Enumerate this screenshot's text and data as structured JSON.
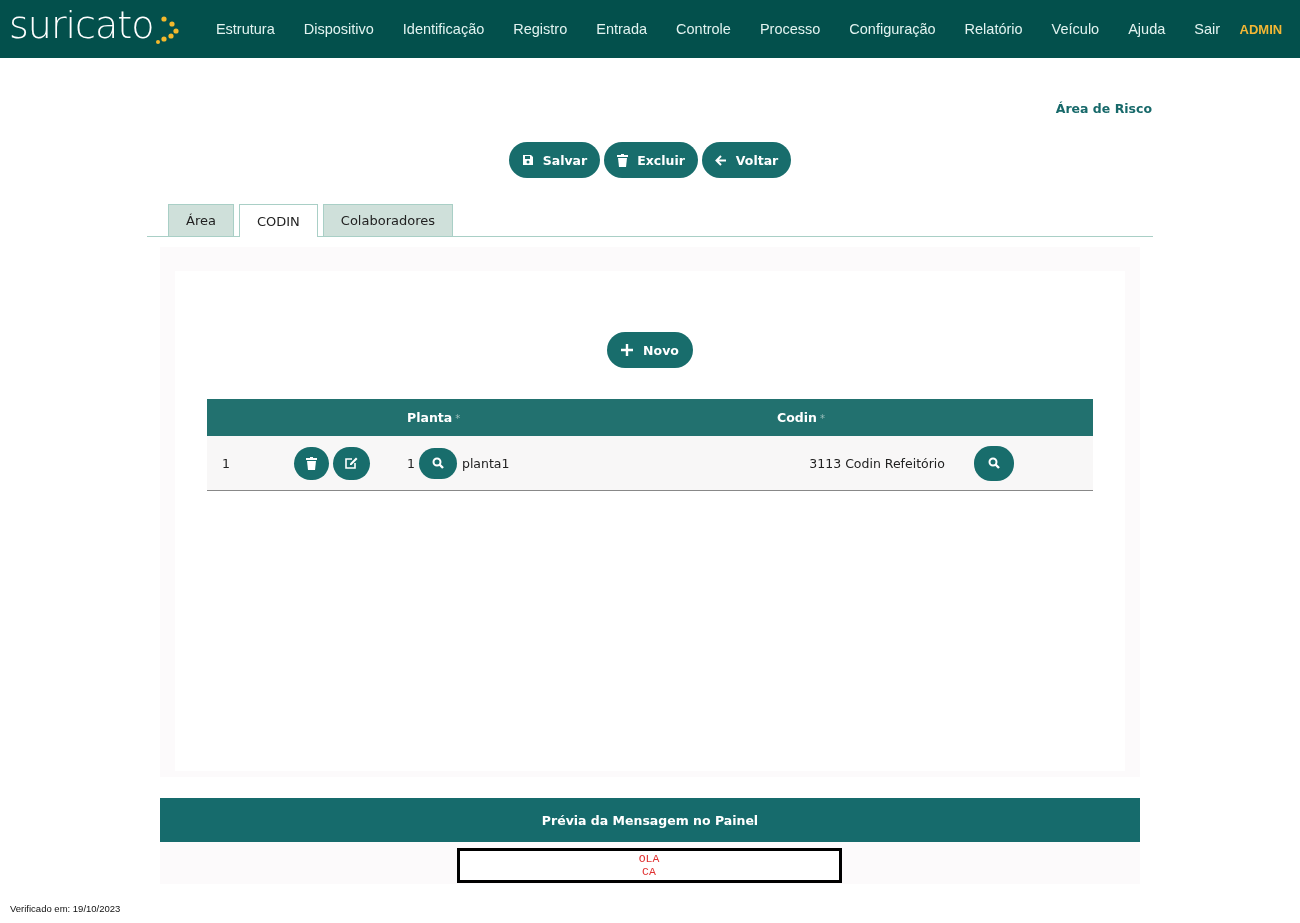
{
  "app": {
    "logo": "suricato",
    "nav": [
      "Estrutura",
      "Dispositivo",
      "Identificação",
      "Registro",
      "Entrada",
      "Controle",
      "Processo",
      "Configuração",
      "Relatório",
      "Veículo",
      "Ajuda",
      "Sair"
    ],
    "user": "ADMIN"
  },
  "page_title": "Área de Risco",
  "actions": [
    {
      "kind": "save",
      "label": "Salvar"
    },
    {
      "kind": "delete",
      "label": "Excluir"
    },
    {
      "kind": "back",
      "label": "Voltar"
    }
  ],
  "tabs": [
    {
      "label": "Área",
      "selected": false
    },
    {
      "label": "CODIN",
      "selected": true
    },
    {
      "label": "Colaboradores",
      "selected": false
    }
  ],
  "new_button": {
    "label": "Novo"
  },
  "table": {
    "columns": [
      {
        "label": "Planta",
        "mark": "*"
      },
      {
        "label": "Codin",
        "mark": "*"
      }
    ],
    "rows": [
      {
        "index": "1",
        "planta_id": "1",
        "planta": "planta1",
        "codin": "3113 Codin Refeitório"
      }
    ]
  },
  "preview": {
    "title": "Prévia da Mensagem no Painel",
    "lines": [
      "OLA",
      "CA"
    ]
  },
  "footer": "Verificado em: 19/10/2023"
}
